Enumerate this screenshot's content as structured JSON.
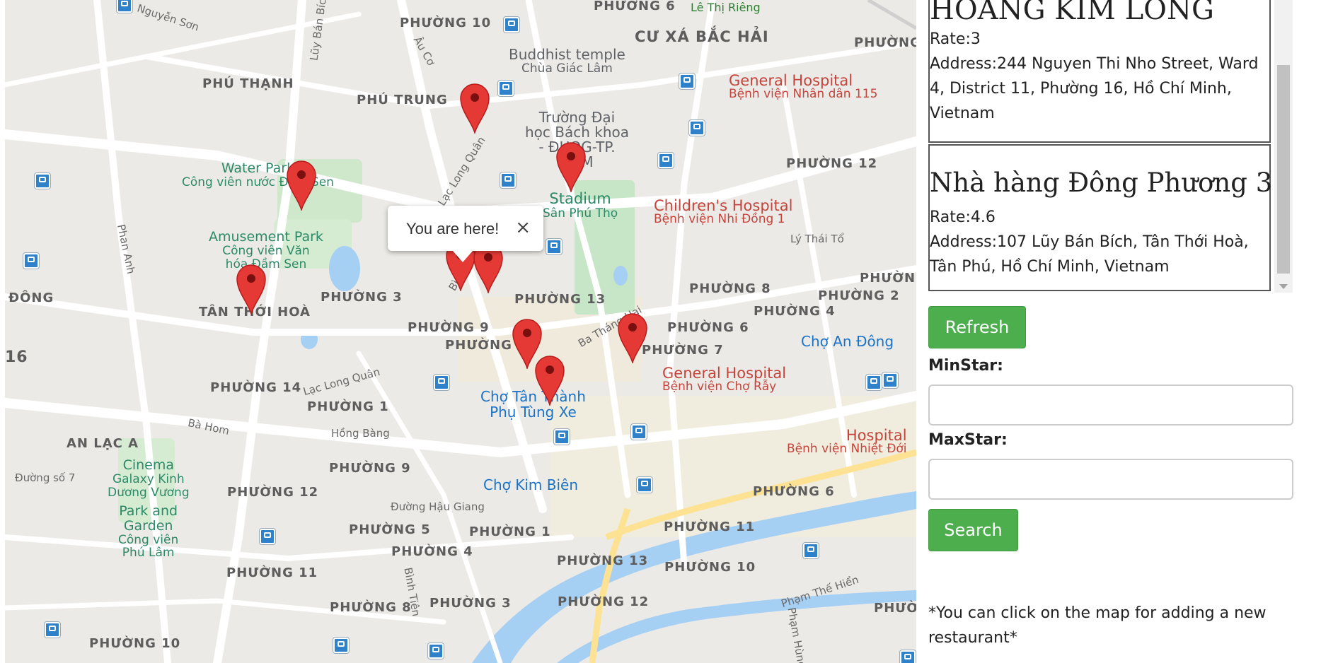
{
  "map": {
    "info_window": {
      "text": "You are here!",
      "close": "×"
    },
    "wards": [
      "PHƯỜNG 10",
      "PHƯỜNG 6",
      "CƯ XÁ BẮC HẢI",
      "PHƯỜNG",
      "PHÚ THẠNH",
      "PHÚ TRUNG",
      "PHƯỜNG 12",
      "PHƯỜNG 3",
      "PHƯỜNG 13",
      "PHƯỜNG 8",
      "PHƯỜNG 2",
      "PHƯỜNG 4",
      "PHƯỜNG 9",
      "PHƯỜNG 6",
      "PHƯỜNG 6",
      "PHƯỜNG 7",
      "PHƯỜNG 14",
      "PHƯỜNG 1",
      "AN LẠC A",
      "PHƯỜNG 9",
      "PHƯỜNG 12",
      "PHƯỜNG 6",
      "PHƯỜNG 5",
      "PHƯỜNG 1",
      "PHƯỜNG 11",
      "PHƯỜNG 4",
      "PHƯỜNG 13",
      "PHƯỜNG 10",
      "PHƯỜNG 11",
      "PHƯỜNG 8",
      "PHƯỜNG 3",
      "PHƯỜNG 12",
      "PHƯỜNG 10",
      "TÂN THỚI HOÀ",
      "ĐÔNG",
      "16",
      "PHƯỜNG",
      "PHƯỜNG"
    ],
    "streets": [
      "Nguyễn Sơn",
      "Lũy Bán Bích",
      "Âu Cơ",
      "Lạc Long Quân",
      "Lê Thị Riêng",
      "Phan Anh",
      "Bình Thới",
      "Ba Tháng Hai",
      "Lý Thái Tổ",
      "Lạc Long Quân",
      "Bà Hom",
      "Hồng Bàng",
      "Đường số 7",
      "Đường Hậu Giang",
      "Bình Tiên",
      "Phạm Thế Hiển",
      "Phạm Hùng"
    ],
    "pois": {
      "buddhist": [
        "Buddhist temple",
        "Chùa Giác Lâm"
      ],
      "university": [
        "Trường Đại",
        "học Bách khoa",
        "- ĐHQG-TP.",
        "HCM"
      ],
      "waterpark": [
        "Water Park",
        "Công viên nước Đầm Sen"
      ],
      "stadium": [
        "Stadium",
        "Sân Phú Thọ"
      ],
      "amusement": [
        "Amusement Park",
        "Công viên Văn",
        "hóa Đầm Sen"
      ],
      "hospital115": [
        "General Hospital",
        "Bệnh viện Nhân dân 115"
      ],
      "children": [
        "Children's Hospital",
        "Bệnh viện Nhi Đồng 1"
      ],
      "choray": [
        "General Hospital",
        "Bệnh viện Chợ Rẫy"
      ],
      "choandong": [
        "Chợ An Đông"
      ],
      "chotanthanh": [
        "Chợ Tân Thành",
        "Phụ Tùng Xe"
      ],
      "cinema": [
        "Cinema",
        "Galaxy Kinh",
        "Dương Vương"
      ],
      "park": [
        "Park and",
        "Garden",
        "Công viên",
        "Phú Lâm"
      ],
      "chokimbien": [
        "Chợ Kim Biên"
      ],
      "nhietdoi": [
        "Hospital",
        "Bệnh viện Nhiệt Đới"
      ]
    },
    "marker_color": "#e53935"
  },
  "restaurants": [
    {
      "name": "HOÀNG KIM LONG",
      "rate": "Rate:3",
      "address": "Address:244 Nguyen Thi Nho Street, Ward 4, District 11, Phường 16, Hồ Chí Minh, Vietnam"
    },
    {
      "name": "Nhà hàng Đông Phương 3",
      "rate": "Rate:4.6",
      "address": "Address:107 Lũy Bán Bích, Tân Thới Hoà, Tân Phú, Hồ Chí Minh, Vietnam"
    }
  ],
  "controls": {
    "refresh_label": "Refresh",
    "min_star_label": "MinStar:",
    "max_star_label": "MaxStar:",
    "search_label": "Search",
    "min_star_value": "",
    "max_star_value": ""
  },
  "note": "*You can click on the map for adding a new restaurant*",
  "colors": {
    "button": "#4cae4c",
    "marker": "#e53935",
    "water": "#a6cff4",
    "highway": "#fde293"
  }
}
